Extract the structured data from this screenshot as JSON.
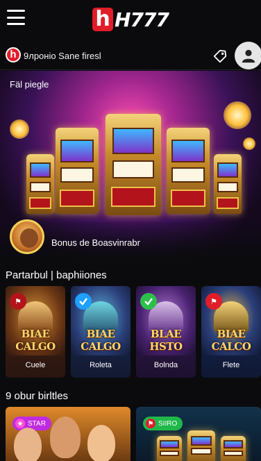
{
  "header": {
    "logo_letter": "h",
    "logo_text": "H777"
  },
  "subbar": {
    "badge_letter": "h",
    "text": "9лроніо Sane firesl"
  },
  "hero": {
    "label": "Fäl piegle",
    "bonus_text": "Bonus de Boasvinrabr"
  },
  "section1": {
    "title": "Partarbul | baphiiones",
    "cards": [
      {
        "art_title": "BIAE CALGO",
        "label": "Cuele",
        "badge": "flag",
        "accent": "#b3141b"
      },
      {
        "art_title": "BIAE CALGO",
        "label": "Roleta",
        "badge": "check",
        "accent": "#1fa0ff"
      },
      {
        "art_title": "BLAE HSTO",
        "label": "Bolnda",
        "badge": "check",
        "accent": "#2cc04a"
      },
      {
        "art_title": "BIAE CALCO",
        "label": "Flete",
        "badge": "flag",
        "accent": "#e11d2a"
      }
    ]
  },
  "section2": {
    "title": "9 obur birltles",
    "cards": [
      {
        "badge_text": "STAR",
        "badge_color": "#c02be0"
      },
      {
        "badge_text": "SIIRO",
        "badge_color": "#1fb84a"
      }
    ]
  },
  "colors": {
    "brand_red": "#e11d2a",
    "accent_gold": "#f3d158"
  }
}
